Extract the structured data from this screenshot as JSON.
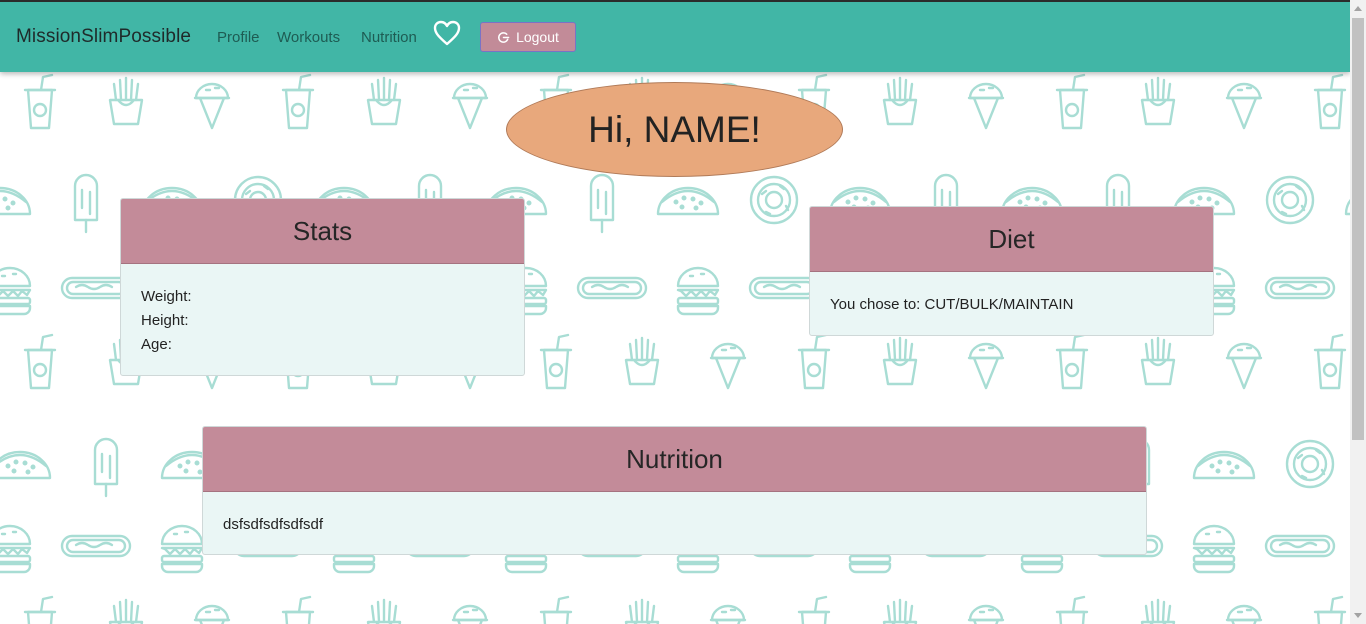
{
  "navbar": {
    "brand": "MissionSlimPossible",
    "links": {
      "profile": "Profile",
      "workouts": "Workouts",
      "nutrition": "Nutrition"
    },
    "logout_label": "Logout"
  },
  "greeting": "Hi, NAME!",
  "stats": {
    "title": "Stats",
    "weight_label": "Weight:",
    "height_label": "Height:",
    "age_label": "Age:"
  },
  "diet": {
    "title": "Diet",
    "choice_text": "You chose to: CUT/BULK/MAINTAIN"
  },
  "nutrition": {
    "title": "Nutrition",
    "body_text": "dsfsdfsdfsdfsdf"
  },
  "colors": {
    "navbar": "#41b6a6",
    "card_header": "#c38b99",
    "card_body": "#eaf6f5",
    "greeting_bubble": "#e8a87c",
    "pattern_icons": "#a8ddd4"
  },
  "background_icons": [
    "soda-cup",
    "fries",
    "ice-cream-cone",
    "popsicle",
    "taco",
    "donut",
    "burger",
    "hot-dog"
  ]
}
